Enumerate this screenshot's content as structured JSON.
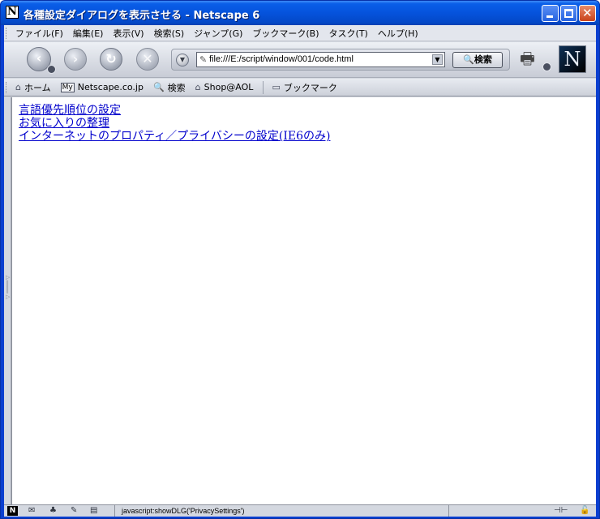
{
  "window": {
    "title": "各種設定ダイアログを表示させる - Netscape 6",
    "app_icon": "N",
    "close_glyph": "✕"
  },
  "menubar": {
    "items": [
      {
        "label": "ファイル(F)"
      },
      {
        "label": "編集(E)"
      },
      {
        "label": "表示(V)"
      },
      {
        "label": "検索(S)"
      },
      {
        "label": "ジャンプ(G)"
      },
      {
        "label": "ブックマーク(B)"
      },
      {
        "label": "タスク(T)"
      },
      {
        "label": "ヘルプ(H)"
      }
    ]
  },
  "navbar": {
    "icons": [
      "back-icon",
      "forward-icon",
      "reload-icon",
      "stop-icon"
    ],
    "url": "file:///E:/script/window/001/code.html",
    "search_label": "検索",
    "throbber": "N"
  },
  "bookmarks": {
    "items": [
      {
        "label": "ホーム",
        "icon": "home-icon"
      },
      {
        "label": "Netscape.co.jp",
        "icon": "my-netscape-icon"
      },
      {
        "label": "検索",
        "icon": "search-icon"
      },
      {
        "label": "Shop@AOL",
        "icon": "shop-icon"
      },
      {
        "label": "ブックマーク",
        "icon": "folder-icon"
      }
    ]
  },
  "content": {
    "links": [
      {
        "label": "言語優先順位の設定"
      },
      {
        "label": "お気に入りの整理"
      },
      {
        "label": "インターネットのプロパティ／プライバシーの設定(IE6のみ)"
      }
    ]
  },
  "statusbar": {
    "text": "javascript:showDLG('PrivacySettings')"
  },
  "colors": {
    "titlebar": "#0553dc",
    "link": "#0000cc"
  }
}
